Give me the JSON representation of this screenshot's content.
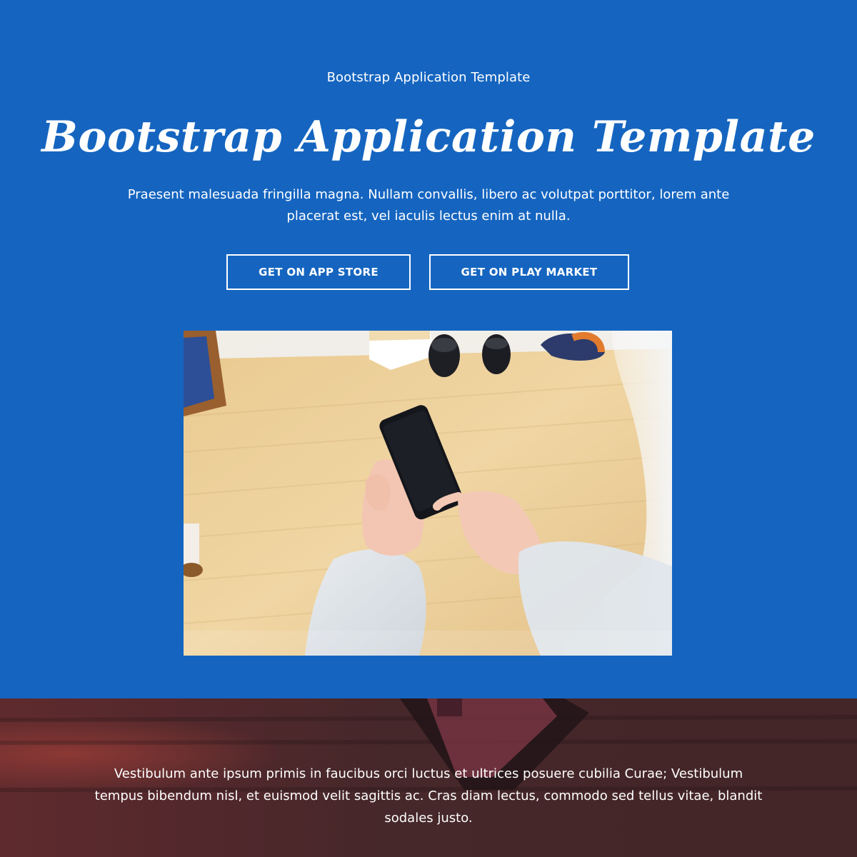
{
  "hero": {
    "eyebrow": "Bootstrap Application Template",
    "headline": "Bootstrap Application Template",
    "lead": "Praesent malesuada fringilla magna. Nullam convallis, libero ac volutpat porttitor, lorem ante placerat est, vel iaculis lectus enim at nulla.",
    "buttons": {
      "app_store": "GET ON APP STORE",
      "play_market": "GET ON PLAY MARKET"
    }
  },
  "footer": {
    "text": "Vestibulum ante ipsum primis in faucibus orci luctus et ultrices posuere cubilia Curae; Vestibulum tempus bibendum nisl, et euismod velit sagittis ac. Cras diam lectus, commodo sed tellus vitae, blandit sodales justo."
  },
  "colors": {
    "hero_background": "#1565c0",
    "button_border": "#ffffff",
    "text": "#ffffff",
    "footer_overlay": "#5a2f36"
  },
  "icons": {
    "photo": "hand-holding-phone-photo"
  }
}
